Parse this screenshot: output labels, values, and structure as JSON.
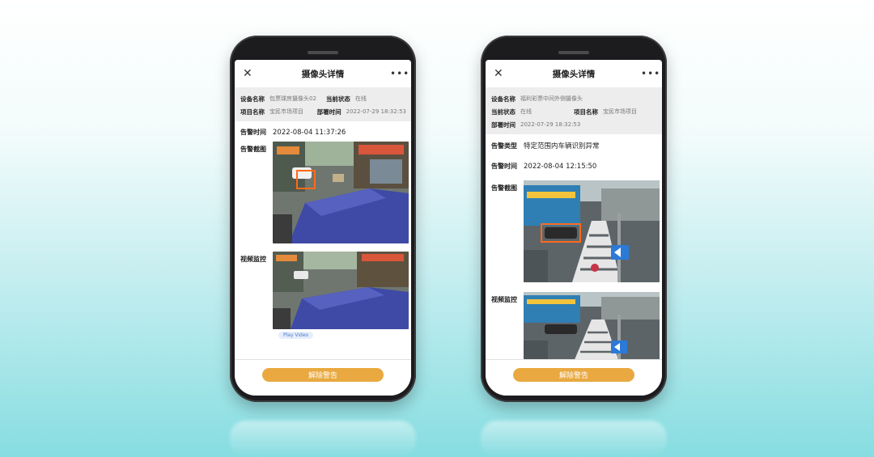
{
  "left_phone": {
    "title": "摄像头详情",
    "close_glyph": "✕",
    "more_glyph": "•••",
    "info": {
      "device_name_label": "设备名称",
      "device_name": "包票球房摄像头02",
      "status_label": "当前状态",
      "status": "在线",
      "project_label": "项目名称",
      "project": "宝民市场项目",
      "deploy_label": "部署时间",
      "deploy_time": "2022-07-29 18:32:53"
    },
    "alarm_time_label": "告警时间",
    "alarm_time": "2022-08-04 11:37:26",
    "snapshot_label": "告警截图",
    "video_label": "视频监控",
    "play_video": "Play Video",
    "dismiss_button": "解除警告"
  },
  "right_phone": {
    "title": "摄像头详情",
    "close_glyph": "✕",
    "more_glyph": "•••",
    "info": {
      "device_name_label": "设备名称",
      "device_name": "福利彩票中间外侧摄像头",
      "status_label": "当前状态",
      "status": "在线",
      "project_label": "项目名称",
      "project": "宝民市场项目",
      "deploy_label": "部署时间",
      "deploy_time": "2022-07-29 18:32:53"
    },
    "alarm_type_label": "告警类型",
    "alarm_type": "特定范围内车辆识别异常",
    "alarm_time_label": "告警时间",
    "alarm_time": "2022-08-04 12:15:50",
    "snapshot_label": "告警截图",
    "video_label": "视频监控",
    "dismiss_button": "解除警告"
  },
  "colors": {
    "accent_button": "#e9a940",
    "info_background": "#ededed",
    "detection_box": "#ff6a1a",
    "play_badge": "#4a78c8"
  },
  "icons": [
    "close-icon",
    "more-icon"
  ]
}
